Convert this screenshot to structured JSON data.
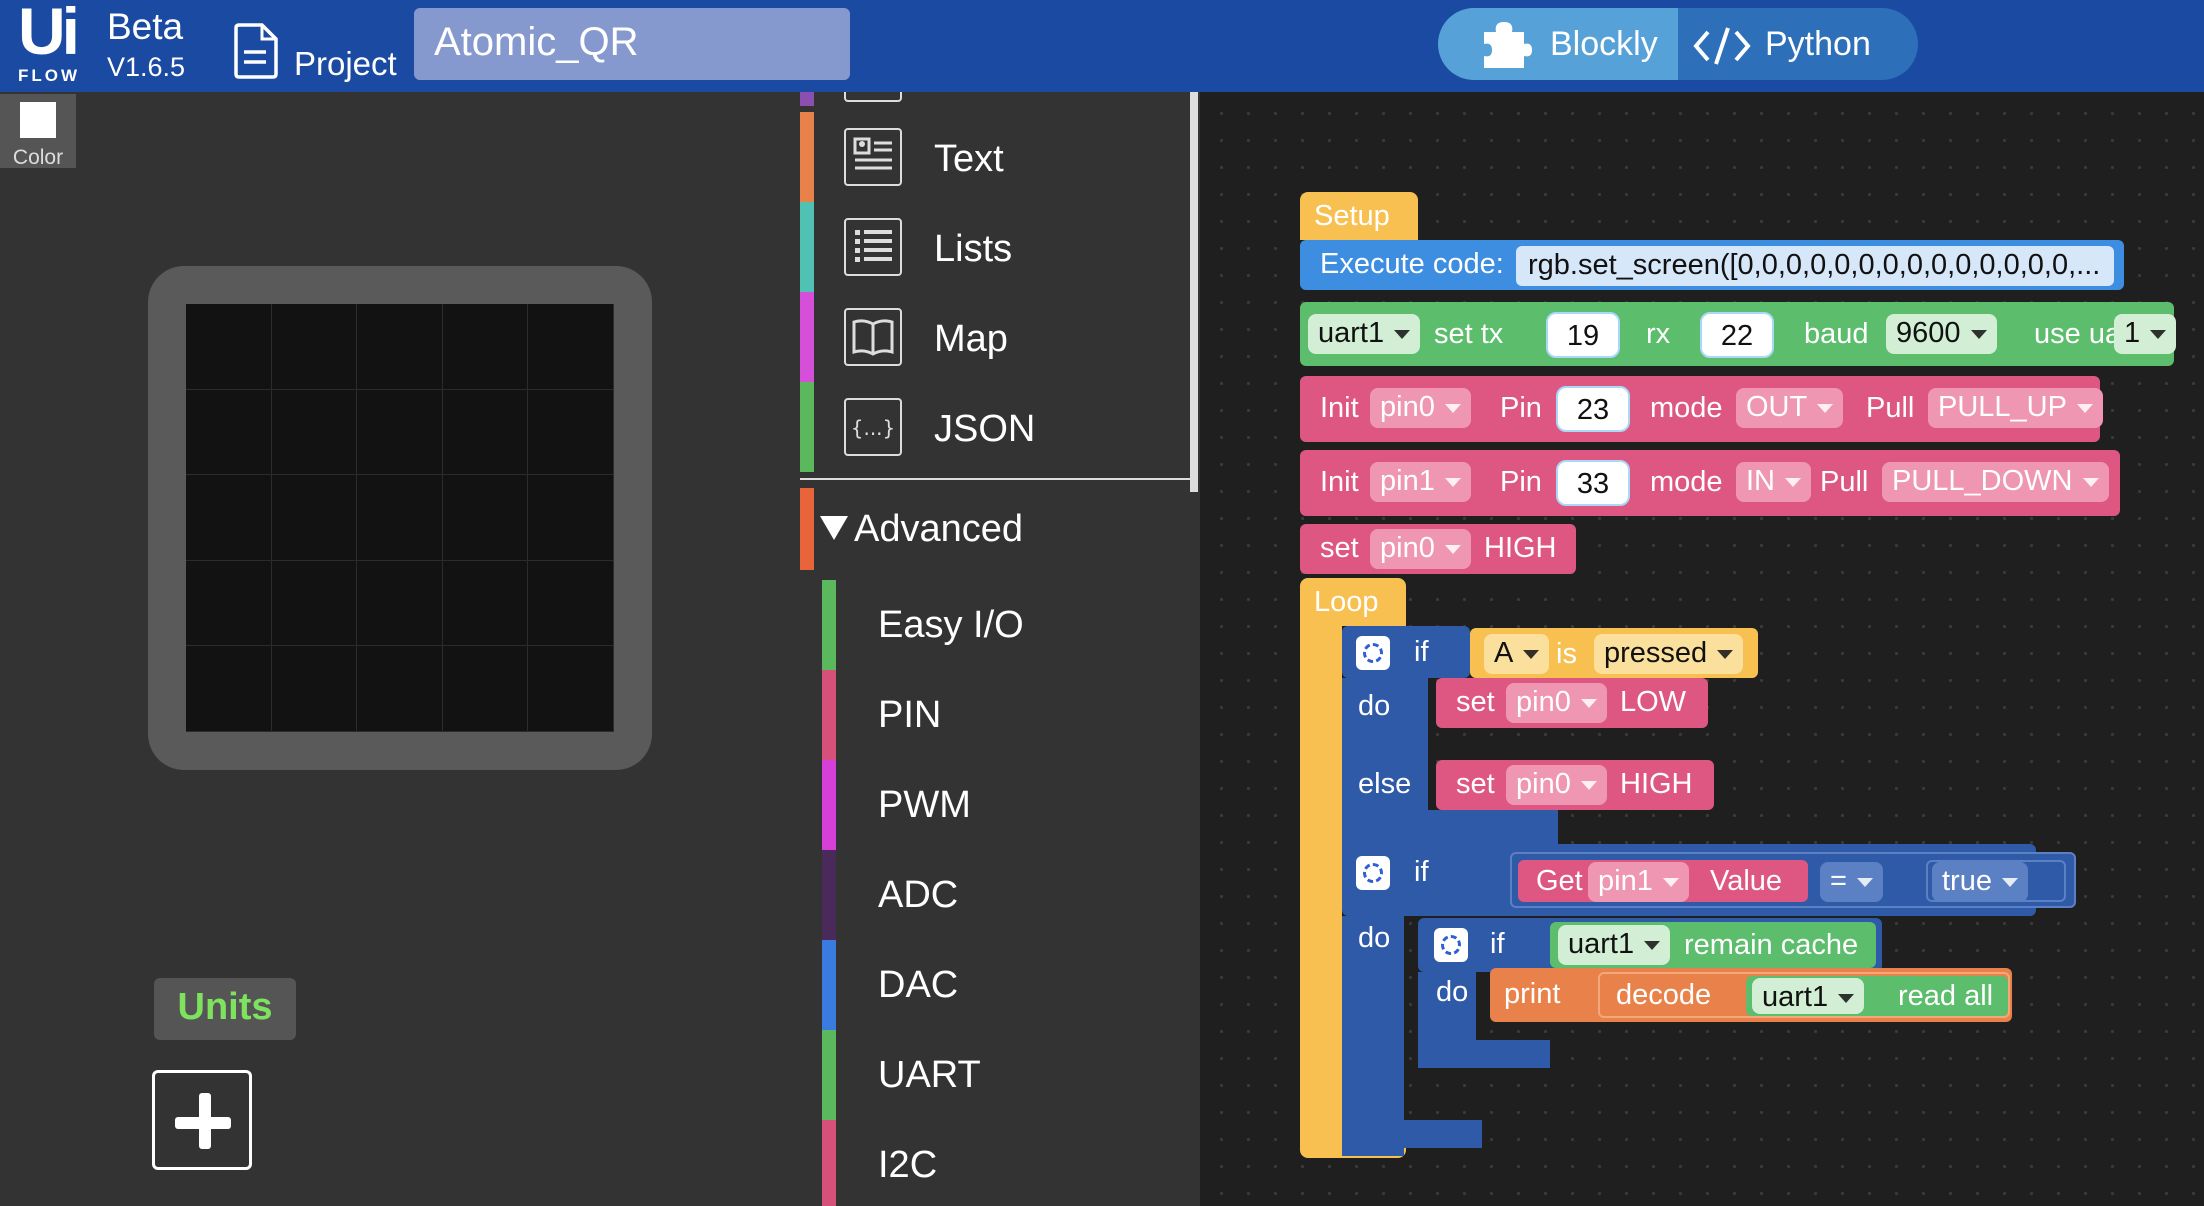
{
  "header": {
    "logo_top": "Ui",
    "logo_bottom": "FLOW",
    "beta": "Beta",
    "version": "V1.6.5",
    "project_label": "Project",
    "project_name": "Atomic_QR",
    "blockly_label": "Blockly",
    "python_label": "Python"
  },
  "left_panel": {
    "color_label": "Color",
    "units_label": "Units"
  },
  "toolbox": {
    "categories": [
      {
        "label": "Text",
        "color": "#e8824a",
        "icon": "text-icon"
      },
      {
        "label": "Lists",
        "color": "#4fc2b3",
        "icon": "list-icon"
      },
      {
        "label": "Map",
        "color": "#d54fd8",
        "icon": "map-icon"
      },
      {
        "label": "JSON",
        "color": "#5cb85c",
        "icon": "json-icon"
      }
    ],
    "advanced_label": "Advanced",
    "advanced_items": [
      {
        "label": "Easy I/O",
        "color": "#5cb85c"
      },
      {
        "label": "PIN",
        "color": "#d5517a"
      },
      {
        "label": "PWM",
        "color": "#d63fd8"
      },
      {
        "label": "ADC",
        "color": "#4a2a5a"
      },
      {
        "label": "DAC",
        "color": "#3a7be0"
      },
      {
        "label": "UART",
        "color": "#5cb85c"
      },
      {
        "label": "I2C",
        "color": "#d5517a"
      }
    ]
  },
  "workspace": {
    "setup": "Setup",
    "exec_label": "Execute code:",
    "exec_code": "rgb.set_screen([0,0,0,0,0,0,0,0,0,0,0,0,0,0,...",
    "uart_name": "uart1",
    "set_tx": "set tx",
    "tx": "19",
    "rx_label": "rx",
    "rx": "22",
    "baud_label": "baud",
    "baud": "9600",
    "use_uart": "use uart",
    "uart_num": "1",
    "init": "Init",
    "pin_label": "Pin",
    "mode_label": "mode",
    "pull_label": "Pull",
    "pin0": "pin0",
    "pin1": "pin1",
    "pin0_num": "23",
    "pin1_num": "33",
    "mode_out": "OUT",
    "mode_in": "IN",
    "pull_up": "PULL_UP",
    "pull_down": "PULL_DOWN",
    "set": "set",
    "high": "HIGH",
    "low": "LOW",
    "loop": "Loop",
    "if": "if",
    "do": "do",
    "else": "else",
    "button_a": "A",
    "is": "is",
    "pressed": "pressed",
    "get": "Get",
    "value": "Value",
    "eq": "=",
    "true": "true",
    "remain_cache": "remain cache",
    "print": "print",
    "decode": "decode",
    "read_all": "read all"
  }
}
